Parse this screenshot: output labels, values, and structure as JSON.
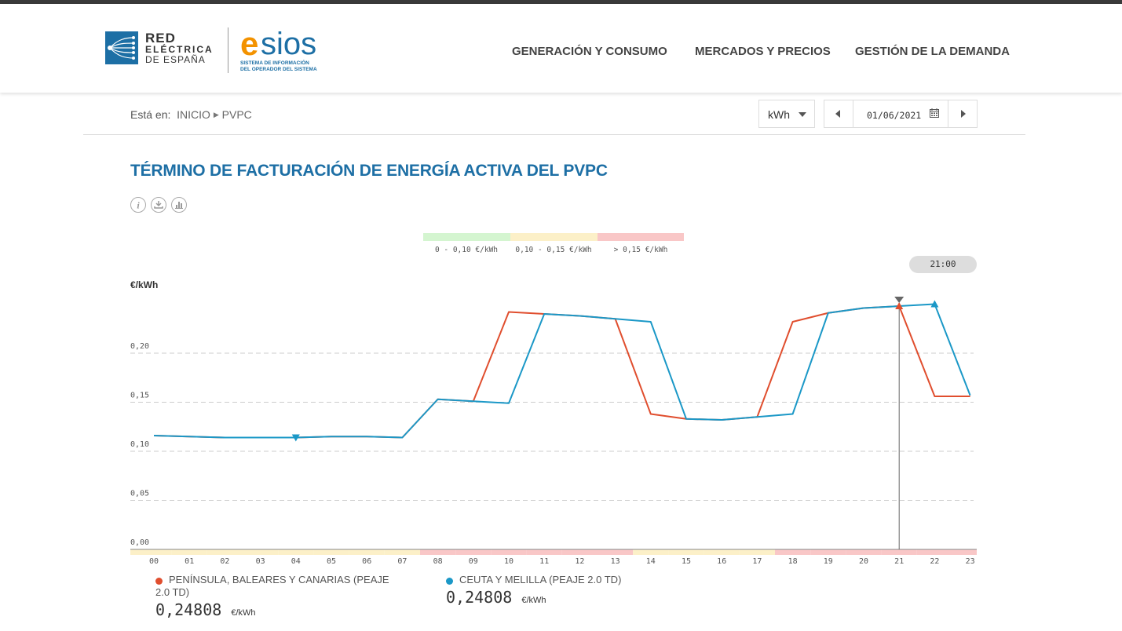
{
  "header": {
    "ree_logo": {
      "line1": "RED",
      "line2": "ELÉCTRICA",
      "line3": "DE ESPAÑA"
    },
    "esios_logo": {
      "e": "e",
      "name": "sios",
      "sub1": "SISTEMA DE INFORMACIÓN",
      "sub2": "DEL OPERADOR DEL SISTEMA"
    },
    "nav": [
      "GENERACIÓN Y CONSUMO",
      "MERCADOS Y PRECIOS",
      "GESTIÓN DE LA DEMANDA"
    ]
  },
  "breadcrumb": {
    "prefix": "Está en:",
    "items": [
      "INICIO",
      "PVPC"
    ]
  },
  "controls": {
    "unit": "kWh",
    "date": "01/06/2021"
  },
  "page_title": "TÉRMINO DE FACTURACIÓN DE ENERGÍA ACTIVA DEL PVPC",
  "tools": [
    "info-icon",
    "download-icon",
    "chart-options-icon"
  ],
  "price_legend": [
    {
      "label": "0 - 0,10 €/kWh",
      "color": "#d4f5d0"
    },
    {
      "label": "0,10 - 0,15 €/kWh",
      "color": "#fcf0c8"
    },
    {
      "label": "> 0,15 €/kWh",
      "color": "#f9c7c7"
    }
  ],
  "selected_hour": "21:00",
  "colors": {
    "peninsula": "#e04e2e",
    "ceuta": "#1b98c7",
    "brand": "#1d6fa5"
  },
  "chart_data": {
    "type": "line",
    "ylabel": "€/kWh",
    "ylim": [
      0,
      0.25
    ],
    "yticks": [
      "0,00",
      "0,05",
      "0,10",
      "0,15",
      "0,20"
    ],
    "categories": [
      "00",
      "01",
      "02",
      "03",
      "04",
      "05",
      "06",
      "07",
      "08",
      "09",
      "10",
      "11",
      "12",
      "13",
      "14",
      "15",
      "16",
      "17",
      "18",
      "19",
      "20",
      "21",
      "22",
      "23"
    ],
    "grid": true,
    "series": [
      {
        "name": "PENÍNSULA, BALEARES Y CANARIAS (PEAJE 2.0 TD)",
        "values": [
          0.116,
          0.115,
          0.114,
          0.114,
          0.114,
          0.115,
          0.115,
          0.114,
          0.153,
          0.151,
          0.242,
          0.24,
          0.238,
          0.235,
          0.138,
          0.133,
          0.132,
          0.135,
          0.232,
          0.241,
          0.246,
          0.248,
          0.156,
          0.156
        ]
      },
      {
        "name": "CEUTA Y MELILLA (PEAJE 2.0 TD)",
        "values": [
          0.116,
          0.115,
          0.114,
          0.114,
          0.114,
          0.115,
          0.115,
          0.114,
          0.153,
          0.151,
          0.149,
          0.24,
          0.238,
          0.235,
          0.232,
          0.133,
          0.132,
          0.135,
          0.138,
          0.241,
          0.246,
          0.248,
          0.25,
          0.157
        ]
      }
    ],
    "hour_price_bands": [
      "yellow",
      "yellow",
      "yellow",
      "yellow",
      "yellow",
      "yellow",
      "yellow",
      "yellow",
      "red",
      "red",
      "red",
      "red",
      "red",
      "red",
      "yellow",
      "yellow",
      "yellow",
      "yellow",
      "red",
      "red",
      "red",
      "red",
      "red",
      "red"
    ]
  },
  "summary": [
    {
      "name": "PENÍNSULA, BALEARES Y CANARIAS (PEAJE",
      "name2": "2.0 TD)",
      "value": "0,24808",
      "unit": "€/kWh"
    },
    {
      "name": "CEUTA Y MELILLA (PEAJE 2.0 TD)",
      "value": "0,24808",
      "unit": "€/kWh"
    }
  ]
}
